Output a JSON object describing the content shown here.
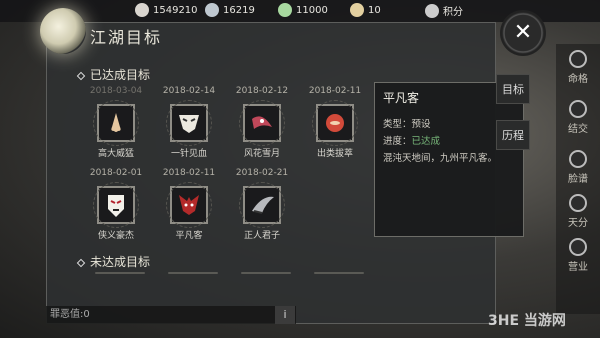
{
  "resources": [
    {
      "name": "coin-icon",
      "value": "1549210",
      "color": "#d9d5cf"
    },
    {
      "name": "silver-icon",
      "value": "16219",
      "color": "#bfc8d0"
    },
    {
      "name": "ticket-icon",
      "value": "11000",
      "color": "#a8d9a0"
    },
    {
      "name": "scroll-icon",
      "value": "10",
      "color": "#e3d0a0"
    },
    {
      "name": "points-icon",
      "value": "积分",
      "color": "#cccccc"
    }
  ],
  "panel": {
    "title": "江湖目标",
    "close_symbol": "✕"
  },
  "achieved": {
    "title": "已达成目标",
    "items": [
      {
        "date": "2018-03-04",
        "name": "高大威猛"
      },
      {
        "date": "2018-02-14",
        "name": "一针见血"
      },
      {
        "date": "2018-02-12",
        "name": "风花雪月"
      },
      {
        "date": "2018-02-11",
        "name": "出类拔萃"
      },
      {
        "date": "2018-02-01",
        "name": "侠义豪杰"
      },
      {
        "date": "2018-02-11",
        "name": "平凡客"
      },
      {
        "date": "2018-02-21",
        "name": "正人君子"
      }
    ]
  },
  "not_achieved": {
    "title": "未达成目标"
  },
  "tooltip": {
    "title": "平凡客",
    "type_label": "类型：预设",
    "progress_label": "进度：",
    "progress_value": "已达成",
    "desc": "混沌天地间，九州平凡客。"
  },
  "side_tabs": {
    "tab1": "目标",
    "tab2": "历程"
  },
  "right_nav": [
    "命格",
    "结交",
    "脸谱",
    "天分",
    "营业"
  ],
  "bottom": {
    "label": "罪恶值:0",
    "info": "i"
  },
  "watermark": "3HE 当游网"
}
